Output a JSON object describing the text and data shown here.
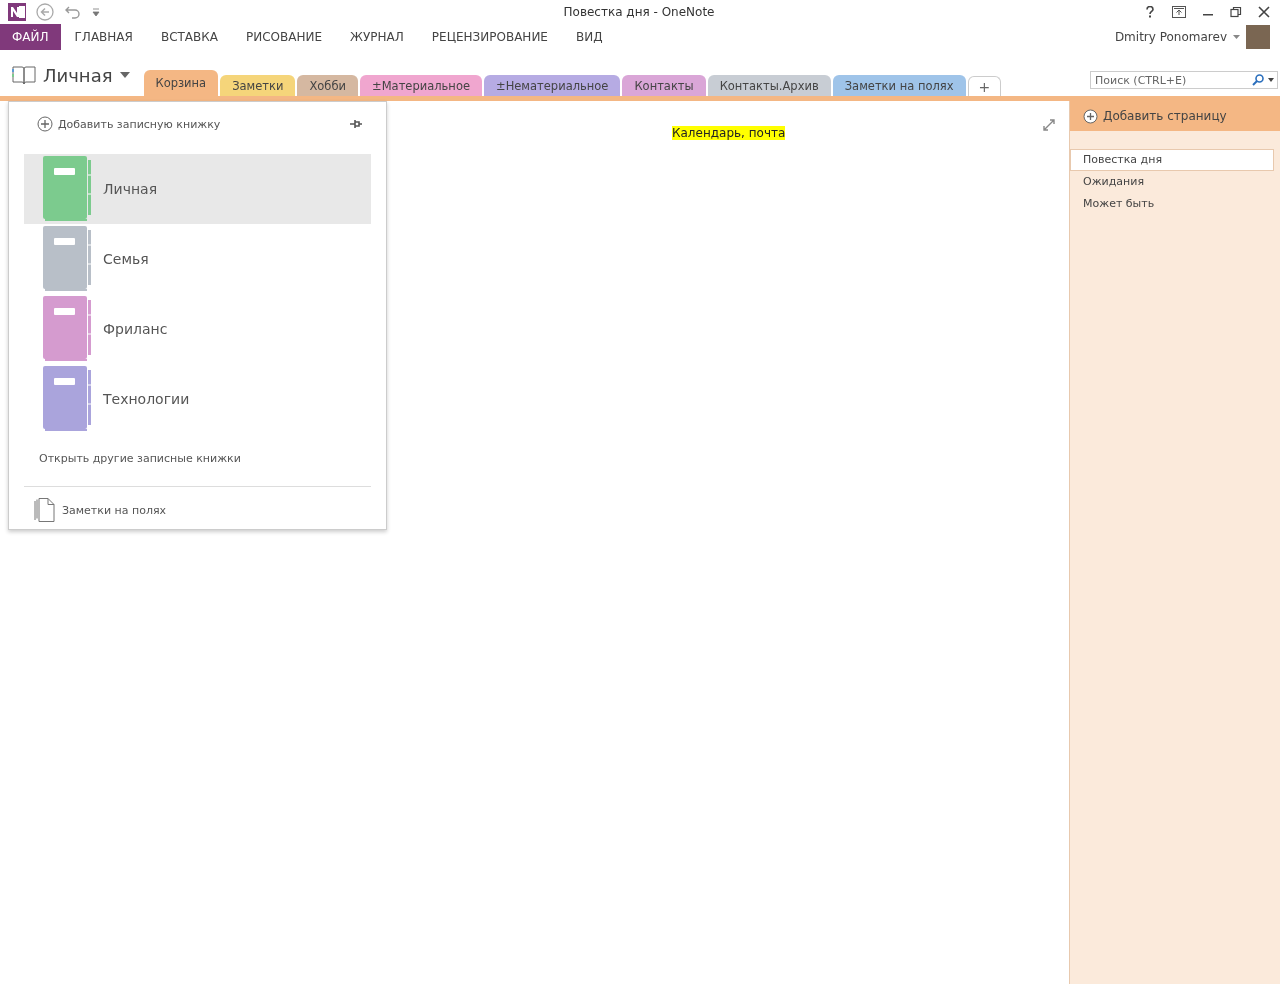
{
  "window": {
    "title": "Повестка дня - OneNote"
  },
  "ribbon": {
    "tabs": [
      {
        "label": "ФАЙЛ",
        "kind": "file",
        "selected": false
      },
      {
        "label": "ГЛАВНАЯ",
        "kind": "tab",
        "selected": false
      },
      {
        "label": "ВСТАВКА",
        "kind": "tab",
        "selected": false
      },
      {
        "label": "РИСОВАНИЕ",
        "kind": "tab",
        "selected": false
      },
      {
        "label": "ЖУРНАЛ",
        "kind": "tab",
        "selected": false
      },
      {
        "label": "РЕЦЕНЗИРОВАНИЕ",
        "kind": "tab",
        "selected": false
      },
      {
        "label": "ВИД",
        "kind": "tab",
        "selected": false
      }
    ],
    "user": "Dmitry Ponomarev"
  },
  "notebook_picker": {
    "label": "Личная"
  },
  "section_tabs": [
    {
      "label": "Корзина",
      "color": "#f4b784",
      "selected": true
    },
    {
      "label": "Заметки",
      "color": "#f5d57a",
      "selected": false
    },
    {
      "label": "Хобби",
      "color": "#d5b8a1",
      "selected": false
    },
    {
      "label": "±Материальное",
      "color": "#f0a6cf",
      "selected": false
    },
    {
      "label": "±Нематериальное",
      "color": "#b6abe3",
      "selected": false
    },
    {
      "label": "Контакты",
      "color": "#daa6d7",
      "selected": false
    },
    {
      "label": "Контакты.Архив",
      "color": "#c8cdd4",
      "selected": false
    },
    {
      "label": "Заметки на полях",
      "color": "#9fc4e9",
      "selected": false
    }
  ],
  "add_section": "+",
  "search": {
    "placeholder": "Поиск (CTRL+E)"
  },
  "note": {
    "title": "Календарь, почта"
  },
  "notebook_menu": {
    "add": "Добавить записную книжку",
    "notebooks": [
      {
        "name": "Личная",
        "color": "#7ccb8e",
        "selected": true
      },
      {
        "name": "Семья",
        "color": "#b8bfc8",
        "selected": false
      },
      {
        "name": "Фриланс",
        "color": "#d59bcf",
        "selected": false
      },
      {
        "name": "Технологии",
        "color": "#aaa4dc",
        "selected": false
      }
    ],
    "open_other": "Открыть другие записные книжки",
    "quick_notes": "Заметки на полях"
  },
  "pages_panel": {
    "add": "Добавить страницу",
    "pages": [
      {
        "title": "Повестка дня",
        "selected": true
      },
      {
        "title": "Ожидания",
        "selected": false
      },
      {
        "title": "Может быть",
        "selected": false
      }
    ]
  }
}
